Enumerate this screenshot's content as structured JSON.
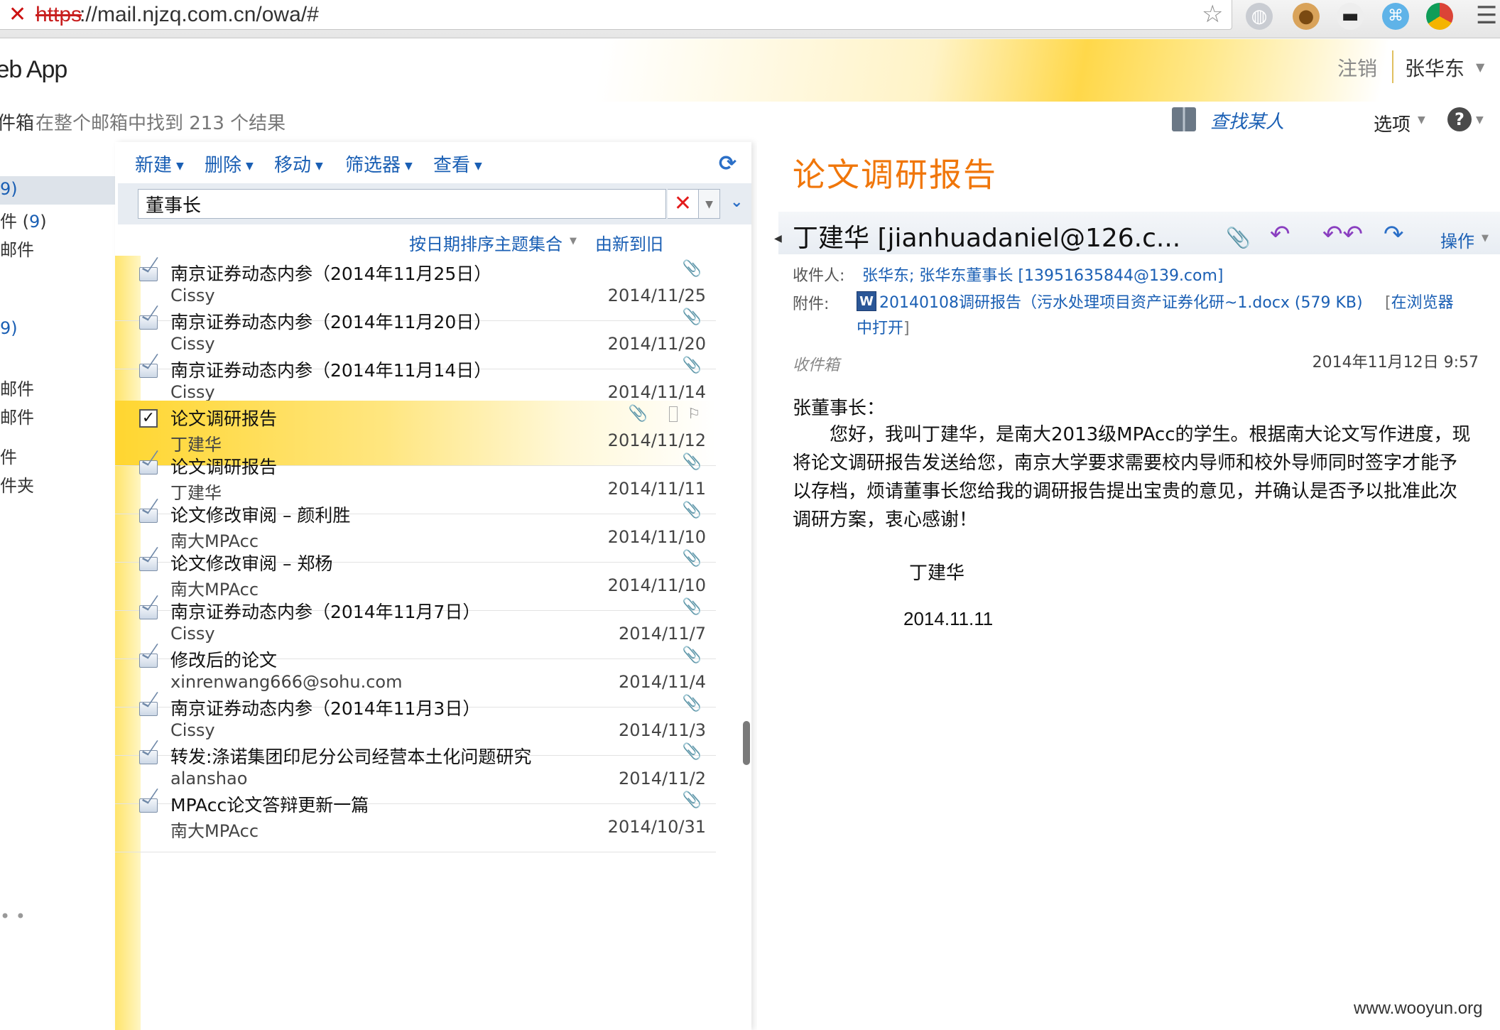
{
  "browser": {
    "url_scheme": "https",
    "url_rest": "://mail.njzq.com.cn/owa/#"
  },
  "header": {
    "brand": "/eb App",
    "signout": "注销",
    "username": "张华东"
  },
  "status": {
    "folder_crumb": "件箱",
    "search_count": "在整个邮箱中找到 213 个结果",
    "find_someone": "查找某人",
    "options": "选项"
  },
  "nav": {
    "items": [
      {
        "label": "9)",
        "count": ""
      },
      {
        "label": "件 (",
        "count": "9"
      },
      {
        "label": "邮件",
        "count": ""
      },
      {
        "label": "9)",
        "count": ""
      },
      {
        "label": "邮件",
        "count": ""
      },
      {
        "label": "邮件",
        "count": ""
      },
      {
        "label": "件",
        "count": ""
      },
      {
        "label": "件夹",
        "count": ""
      }
    ]
  },
  "toolbar": {
    "new": "新建",
    "delete": "删除",
    "move": "移动",
    "filter": "筛选器",
    "view": "查看"
  },
  "search": {
    "value": "董事长"
  },
  "sort": {
    "by": "按日期排序主题集合",
    "order": "由新到旧"
  },
  "messages": [
    {
      "subject": "南京证券动态内参（2014年11月25日）",
      "from": "Cissy",
      "date": "2014/11/25"
    },
    {
      "subject": "南京证券动态内参（2014年11月20日）",
      "from": "Cissy",
      "date": "2014/11/20"
    },
    {
      "subject": "南京证券动态内参（2014年11月14日）",
      "from": "Cissy",
      "date": "2014/11/14"
    },
    {
      "subject": "论文调研报告",
      "from": "丁建华",
      "date": "2014/11/12"
    },
    {
      "subject": "论文调研报告",
      "from": "丁建华",
      "date": "2014/11/11"
    },
    {
      "subject": "论文修改审阅 – 颜利胜",
      "from": "南大MPAcc",
      "date": "2014/11/10"
    },
    {
      "subject": "论文修改审阅 – 郑杨",
      "from": "南大MPAcc",
      "date": "2014/11/10"
    },
    {
      "subject": "南京证券动态内参（2014年11月7日）",
      "from": "Cissy",
      "date": "2014/11/7"
    },
    {
      "subject": "修改后的论文",
      "from": "xinrenwang666@sohu.com",
      "date": "2014/11/4"
    },
    {
      "subject": "南京证券动态内参（2014年11月3日）",
      "from": "Cissy",
      "date": "2014/11/3"
    },
    {
      "subject": "转发:涤诺集团印尼分公司经营本土化问题研究",
      "from": "alanshao",
      "date": "2014/11/2"
    },
    {
      "subject": "MPAcc论文答辩更新一篇",
      "from": "南大MPAcc",
      "date": "2014/10/31"
    }
  ],
  "reading": {
    "title": "论文调研报告",
    "from": "丁建华 [jianhuadaniel@126.c...",
    "actions": "操作",
    "to_label": "收件人:",
    "to_value": "张华东; 张华东董事长 [13951635844@139.com]",
    "att_label": "附件:",
    "att_value": "20140108调研报告（污水处理项目资产证券化研~1.docx (579 KB)",
    "att_open_1": "在浏览器",
    "att_open_2": "中打开",
    "folder": "收件箱",
    "sent_time": "2014年11月12日 9:57",
    "greeting": "张董事长：",
    "body": "您好，我叫丁建华，是南大2013级MPAcc的学生。根据南大论文写作进度，现将论文调研报告发送给您，南京大学要求需要校内导师和校外导师同时签字才能予以存档，烦请董事长您给我的调研报告提出宝贵的意见，并确认是否予以批准此次调研方案，衷心感谢！",
    "signature": "丁建华",
    "date": "2014.11.11"
  },
  "watermark": "www.wooyun.org"
}
